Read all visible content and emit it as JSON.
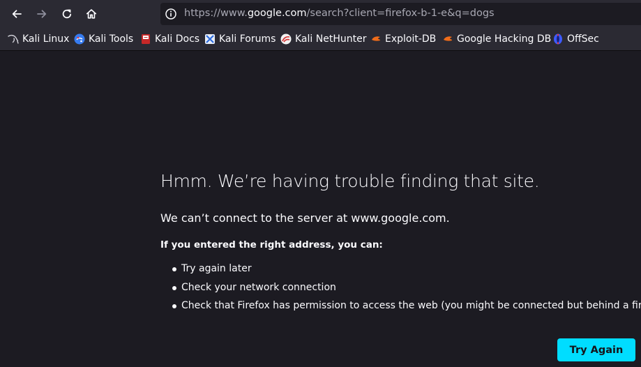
{
  "toolbar": {
    "back_icon": "arrow-left-icon",
    "forward_icon": "arrow-right-icon",
    "reload_icon": "reload-icon",
    "home_icon": "home-icon"
  },
  "urlbar": {
    "prefix": "https://www.",
    "host": "google.com",
    "path": "/search?client=firefox-b-1-e&q=dogs"
  },
  "bookmarks": [
    {
      "label": "Kali Linux",
      "icon": "kali-dragon-icon"
    },
    {
      "label": "Kali Tools",
      "icon": "kali-tools-icon"
    },
    {
      "label": "Kali Docs",
      "icon": "kali-docs-icon"
    },
    {
      "label": "Kali Forums",
      "icon": "kali-forums-icon"
    },
    {
      "label": "Kali NetHunter",
      "icon": "nethunter-icon"
    },
    {
      "label": "Exploit-DB",
      "icon": "exploit-db-icon"
    },
    {
      "label": "Google Hacking DB",
      "icon": "ghdb-icon"
    },
    {
      "label": "OffSec",
      "icon": "offsec-icon"
    }
  ],
  "error": {
    "title": "Hmm. We’re having trouble finding that site.",
    "description": "We can’t connect to the server at www.google.com.",
    "subheading": "If you entered the right address, you can:",
    "steps": [
      "Try again later",
      "Check your network connection",
      "Check that Firefox has permission to access the web (you might be connected but behind a firewall)"
    ],
    "button_label": "Try Again"
  },
  "colors": {
    "page_bg": "#1c1b22",
    "chrome_bg": "#2b2a33",
    "accent": "#00ddff",
    "text": "#fbfbfe"
  }
}
